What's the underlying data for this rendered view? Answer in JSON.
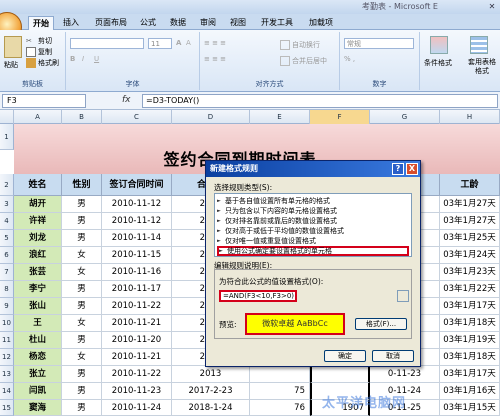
{
  "window": {
    "title": "考勤表 - Microsoft E"
  },
  "tabs": [
    "开始",
    "插入",
    "页面布局",
    "公式",
    "数据",
    "审阅",
    "视图",
    "开发工具",
    "加载项"
  ],
  "ribbon": {
    "clipboard": {
      "paste": "粘贴",
      "cut": "剪切",
      "copy": "复制",
      "format_painter": "格式刷",
      "label": "剪贴板"
    },
    "font": {
      "size": "11",
      "label": "字体"
    },
    "alignment": {
      "wrap": "自动换行",
      "merge": "合并后居中",
      "label": "对齐方式"
    },
    "number": {
      "format": "常规",
      "label": "数字"
    },
    "styles": {
      "conditional": "条件格式",
      "table": "套用表格格式"
    }
  },
  "formula_bar": {
    "name_box": "F3",
    "fx": "fx",
    "formula": "=D3-TODAY()"
  },
  "columns": [
    "A",
    "B",
    "C",
    "D",
    "E",
    "F",
    "G",
    "H"
  ],
  "rows": [
    "1",
    "2",
    "3",
    "4",
    "5",
    "6",
    "7",
    "8",
    "9",
    "10",
    "11",
    "12",
    "13",
    "14",
    "15",
    "16",
    "17"
  ],
  "sheet": {
    "title": "签约合同到期时间表",
    "headers": [
      "姓名",
      "性别",
      "签订合同时间",
      "合同到",
      "",
      "",
      "时间",
      "工龄"
    ],
    "data": [
      {
        "name": "胡开",
        "sex": "男",
        "sign": "2010-11-12",
        "due": "2013",
        "h": "0-11-13",
        "age": "03年1月27天"
      },
      {
        "name": "许祥",
        "sex": "男",
        "sign": "2010-11-12",
        "due": "2013",
        "h": "0-11-13",
        "age": "03年1月27天"
      },
      {
        "name": "刘龙",
        "sex": "男",
        "sign": "2010-11-14",
        "due": "2013",
        "h": "0-11-15",
        "age": "03年1月25天"
      },
      {
        "name": "浪红",
        "sex": "女",
        "sign": "2010-11-15",
        "due": "2012",
        "h": "0-11-16",
        "age": "03年1月24天"
      },
      {
        "name": "张芸",
        "sex": "女",
        "sign": "2010-11-16",
        "due": "2013",
        "h": "0-11-17",
        "age": "03年1月23天"
      },
      {
        "name": "李宁",
        "sex": "男",
        "sign": "2010-11-17",
        "due": "2013",
        "h": "0-11-18",
        "age": "03年1月22天"
      },
      {
        "name": "张山",
        "sex": "男",
        "sign": "2010-11-22",
        "due": "2013",
        "h": "0-11-23",
        "age": "03年1月17天"
      },
      {
        "name": "王",
        "sex": "女",
        "sign": "2010-11-21",
        "due": "2013",
        "h": "0-11-22",
        "age": "03年1月18天"
      },
      {
        "name": "杜山",
        "sex": "男",
        "sign": "2010-11-20",
        "due": "2013",
        "h": "0-11-21",
        "age": "03年1月19天"
      },
      {
        "name": "杨恋",
        "sex": "女",
        "sign": "2010-11-21",
        "due": "2013",
        "h": "0-11-22",
        "age": "03年1月18天"
      },
      {
        "name": "张立",
        "sex": "男",
        "sign": "2010-11-22",
        "due": "2013",
        "h": "0-11-23",
        "age": "03年1月17天"
      },
      {
        "name": "闫凯",
        "sex": "男",
        "sign": "2010-11-23",
        "due": "2017-2-23",
        "e": "75",
        "f": "",
        "h": "0-11-24",
        "age": "03年1月16天"
      },
      {
        "name": "窦海",
        "sex": "男",
        "sign": "2010-11-24",
        "due": "2018-1-24",
        "e": "76",
        "f": "1907",
        "h": "0-11-25",
        "age": "03年1月15天"
      },
      {
        "name": "赵",
        "sex": "女",
        "sign": "2010-11-25",
        "due": "2018-7-25",
        "e": "77",
        "f": "1689",
        "h": "2010-11-25",
        "age": "03年1月14天"
      }
    ]
  },
  "dialog": {
    "title": "新建格式规则",
    "help": "?",
    "close": "X",
    "select_type_label": "选择规则类型(S):",
    "rules": [
      "基于各自值设置所有单元格的格式",
      "只为包含以下内容的单元格设置格式",
      "仅对排名靠前或靠后的数值设置格式",
      "仅对高于或低于平均值的数值设置格式",
      "仅对唯一值或重复值设置格式",
      "使用公式确定要设置格式的单元格"
    ],
    "edit_label": "编辑规则说明(E):",
    "formula_label": "为符合此公式的值设置格式(O):",
    "formula_value": "=AND(F3<10,F3>0)",
    "preview_label": "预览:",
    "preview_text": "微软卓越  AaBbCc",
    "format_button": "格式(F)...",
    "ok": "确定",
    "cancel": "取消"
  },
  "watermark": "太平洋电脑网"
}
